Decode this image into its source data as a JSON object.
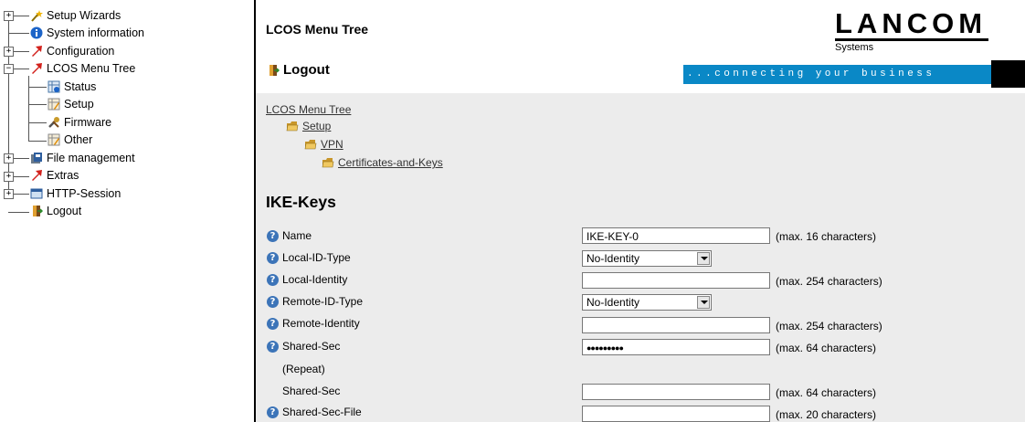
{
  "tree": {
    "items": [
      {
        "label": "Setup Wizards",
        "expander": "+"
      },
      {
        "label": "System information"
      },
      {
        "label": "Configuration",
        "expander": "+"
      },
      {
        "label": "LCOS Menu Tree",
        "expander": "−"
      },
      {
        "label": "Status"
      },
      {
        "label": "Setup"
      },
      {
        "label": "Firmware"
      },
      {
        "label": "Other"
      },
      {
        "label": "File management",
        "expander": "+"
      },
      {
        "label": "Extras",
        "expander": "+"
      },
      {
        "label": "HTTP-Session",
        "expander": "+"
      },
      {
        "label": "Logout"
      }
    ]
  },
  "header": {
    "title": "LCOS Menu Tree",
    "logo_word": "LANCOM",
    "logo_sub": "Systems",
    "logout": "Logout",
    "slogan": "...connecting your business"
  },
  "breadcrumb": [
    "LCOS Menu Tree",
    "Setup",
    "VPN",
    "Certificates-and-Keys"
  ],
  "page": {
    "heading": "IKE-Keys",
    "fields": [
      {
        "label": "Name",
        "help": true,
        "kind": "text",
        "value": "IKE-KEY-0",
        "hint": "(max. 16 characters)"
      },
      {
        "label": "Local-ID-Type",
        "help": true,
        "kind": "select",
        "value": "No-Identity",
        "hint": ""
      },
      {
        "label": "Local-Identity",
        "help": true,
        "kind": "text",
        "value": "",
        "hint": "(max. 254 characters)"
      },
      {
        "label": "Remote-ID-Type",
        "help": true,
        "kind": "select",
        "value": "No-Identity",
        "hint": ""
      },
      {
        "label": "Remote-Identity",
        "help": true,
        "kind": "text",
        "value": "",
        "hint": "(max. 254 characters)"
      },
      {
        "label": "Shared-Sec",
        "help": true,
        "kind": "password",
        "value": "●●●●●●●●●",
        "hint": "(max. 64 characters)"
      },
      {
        "label": "(Repeat)",
        "help": false,
        "kind": "none",
        "value": "",
        "hint": ""
      },
      {
        "label": "Shared-Sec",
        "help": false,
        "kind": "text",
        "value": "",
        "hint": "(max. 64 characters)"
      },
      {
        "label": "Shared-Sec-File",
        "help": true,
        "kind": "text",
        "value": "",
        "hint": "(max. 20 characters)"
      }
    ]
  },
  "colors": {
    "slogan_bg": "#0a88c6",
    "content_bg": "#ececec",
    "help_icon": "#3c74b8"
  }
}
